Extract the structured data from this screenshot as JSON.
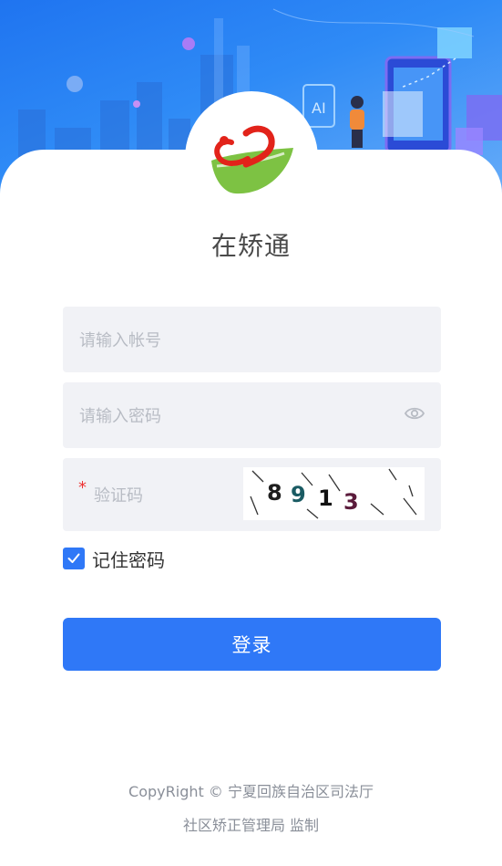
{
  "app": {
    "title": "在矫通"
  },
  "form": {
    "account_placeholder": "请输入帐号",
    "password_placeholder": "请输入密码",
    "captcha_required_mark": "*",
    "captcha_placeholder": "验证码",
    "captcha_image_text": "8913",
    "remember_label": "记住密码",
    "remember_checked": true,
    "login_label": "登录"
  },
  "footer": {
    "line1": "CopyRight © 宁夏回族自治区司法厅",
    "line2": "社区矫正管理局 监制"
  },
  "colors": {
    "primary": "#2f78f7",
    "field_bg": "#f1f2f6",
    "hero": "#1f74f0"
  },
  "icons": [
    "eye-icon",
    "check-icon",
    "app-logo"
  ]
}
